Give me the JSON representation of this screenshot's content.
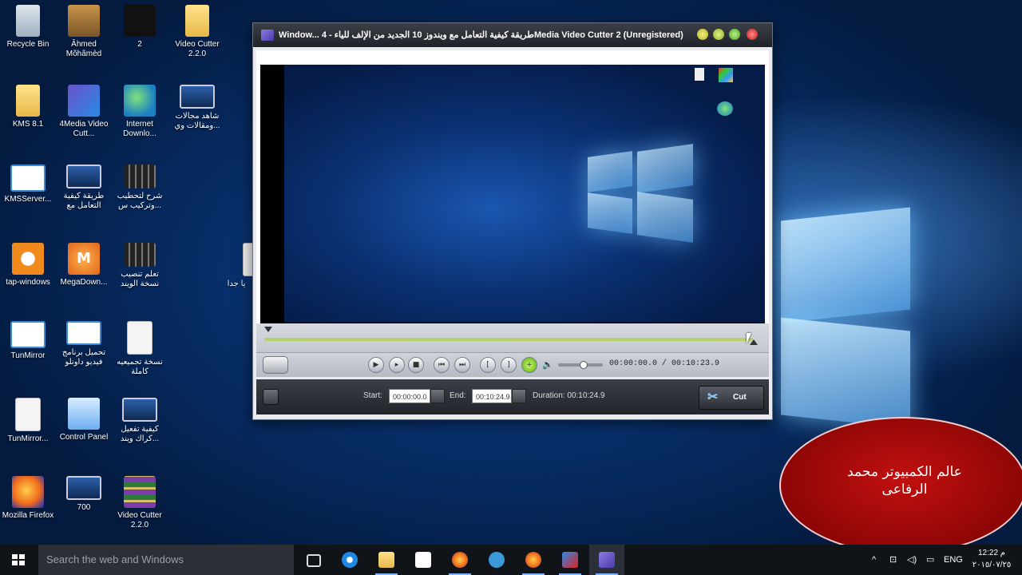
{
  "desktop": {
    "icons": [
      {
        "id": "recycle-bin",
        "label": "Recycle Bin",
        "icon": "recycle-bin-icon"
      },
      {
        "id": "ahmed",
        "label": "Âhmed Mõhãmèd",
        "icon": "box-icon"
      },
      {
        "id": "two",
        "label": "2",
        "icon": "dark-image-icon"
      },
      {
        "id": "video-cutter-folder",
        "label": "Video Cutter 2.2.0",
        "icon": "folder-icon"
      },
      {
        "id": "kms",
        "label": "KMS 8.1",
        "icon": "folder-icon"
      },
      {
        "id": "4media",
        "label": "4Media Video Cutt...",
        "icon": "4media-app-icon"
      },
      {
        "id": "idm",
        "label": "Internet Downlo...",
        "icon": "internet-download-manager-icon"
      },
      {
        "id": "ar-video",
        "label": "شاهد مجالات ومقالات وي...",
        "icon": "video-file-icon"
      },
      {
        "id": "kmsserver",
        "label": "KMSServer...",
        "icon": "window-app-icon"
      },
      {
        "id": "ar-howto",
        "label": "طريقة كيفية التعامل مع",
        "icon": "video-file-icon"
      },
      {
        "id": "ar-explain",
        "label": "شرح لتحطيب وتركيب س...",
        "icon": "film-icon"
      },
      {
        "id": "tap",
        "label": "tap-windows",
        "icon": "vpn-tap-icon"
      },
      {
        "id": "mega",
        "label": "MegaDown...",
        "icon": "mega-download-icon"
      },
      {
        "id": "ar-learn",
        "label": "تعلم تنصيب نسخة الويند",
        "icon": "film-icon"
      },
      {
        "id": "tunmirror",
        "label": "TunMirror",
        "icon": "window-app-icon"
      },
      {
        "id": "ar-download",
        "label": "تحميل برنامج فيديو داونلو",
        "icon": "window-app-icon"
      },
      {
        "id": "ar-copy",
        "label": "نسخة تجميعيه كاملة",
        "icon": "document-icon"
      },
      {
        "id": "tunmirror2",
        "label": "TunMirror...",
        "icon": "document-icon"
      },
      {
        "id": "control-panel",
        "label": "Control Panel",
        "icon": "control-panel-icon"
      },
      {
        "id": "ar-activate",
        "label": "كيفية تفعيل كراك ويند...",
        "icon": "video-file-icon"
      },
      {
        "id": "firefox",
        "label": "Mozilla Firefox",
        "icon": "firefox-icon"
      },
      {
        "id": "700",
        "label": "700",
        "icon": "monitor-icon"
      },
      {
        "id": "video-cutter-2",
        "label": "Video Cutter 2.2.0",
        "icon": "winrar-icon"
      },
      {
        "id": "partial",
        "label": "يا جدا",
        "icon": "document-icon"
      }
    ]
  },
  "window": {
    "title": "Window... طريقة كيفية التعامل مع ويندوز 10 الجديد من الإلف للياء - 4Media Video Cutter 2 (Unregistered)",
    "time_display": "00:00:00.0 / 00:10:23.9",
    "start_label": "Start:",
    "start_value": "00:00:00.0",
    "end_label": "End:",
    "end_value": "00:10:24.9",
    "duration_label": "Duration: 00:10:24.9",
    "cut_label": "Cut",
    "progress": 0.0,
    "volume_level": 0.55
  },
  "overlay": {
    "text": "عالم الكمبيوتر محمد الرفاعى"
  },
  "taskbar": {
    "search_placeholder": "Search the web and Windows",
    "apps": [
      "task-view-icon",
      "edge-icon",
      "file-explorer-icon",
      "store-icon",
      "firefox-icon",
      "skype-icon",
      "firefox-icon",
      "video-editor-icon",
      "4media-app-icon"
    ],
    "tray": {
      "language": "ENG",
      "time": "12:22 م",
      "date": "٢٠١٥/٠٧/٢٥"
    }
  }
}
